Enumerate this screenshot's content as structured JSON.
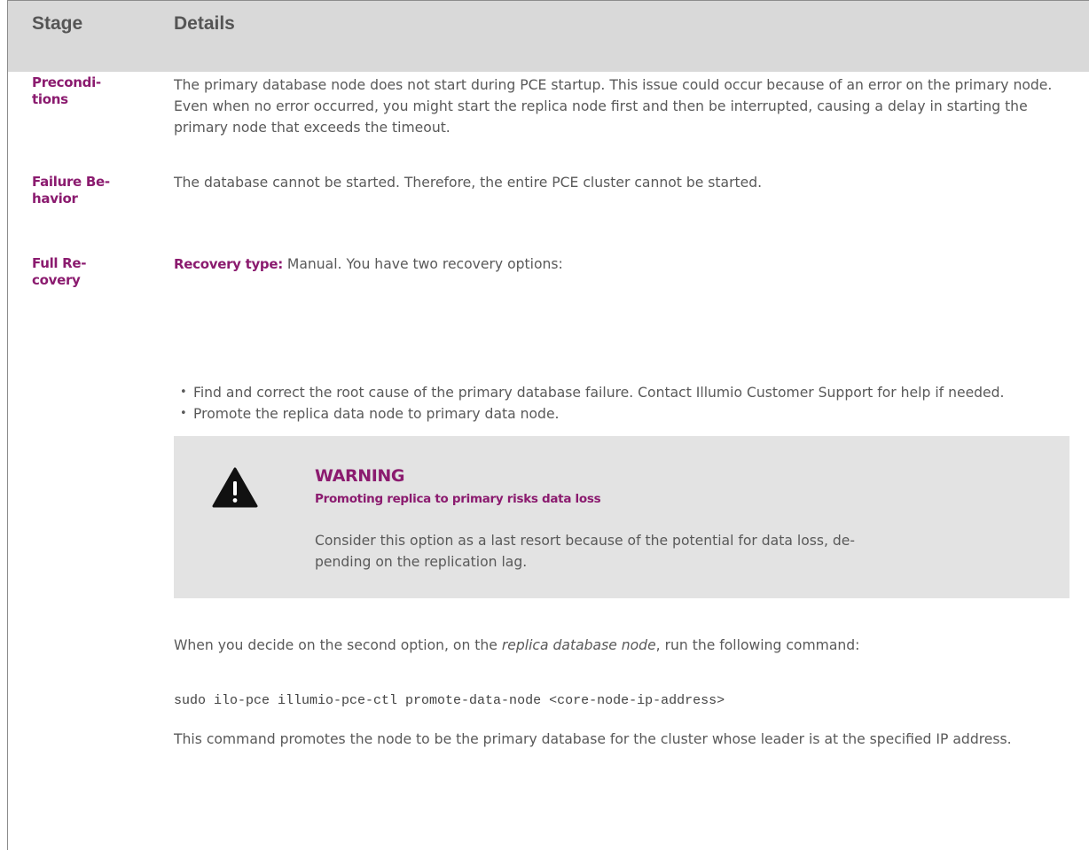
{
  "table": {
    "header": {
      "stage": "Stage",
      "details": "Details"
    },
    "rows": [
      {
        "stage": "Precondi-\ntions",
        "details": "The primary database node does not start during PCE startup. This issue could occur because of an error on the primary node. Even when no error occurred, you might start the replica node first and then be interrupted, causing a delay in starting the primary node that exceeds the timeout."
      },
      {
        "stage": "Failure Be-\nhavior",
        "details": "The database cannot be started. Therefore, the entire PCE cluster cannot be started."
      },
      {
        "stage": "Full Re-\ncovery",
        "recovery_label": "Recovery type:",
        "recovery_text": " Manual. You have two recovery options:",
        "bullets": [
          "Find and correct the root cause of the primary database failure. Contact Illumio Customer Support for help if needed.",
          "Promote the replica data node to primary data node."
        ],
        "warning": {
          "icon": "warning-triangle-icon",
          "title": "WARNING",
          "subtitle": "Promoting replica to primary risks data loss",
          "body": "Consider this option as a last resort because of the potential for data loss, de-\npending on the replication lag."
        },
        "second_option": {
          "before": "When you decide on the second option, on the ",
          "emphasis": "replica database node",
          "after": ", run the following command:"
        },
        "command": "sudo ilo-pce illumio-pce-ctl promote-data-node <core-node-ip-address>",
        "closing": "This command promotes the node to be the primary database for the cluster whose leader is at the specified IP address."
      }
    ]
  }
}
